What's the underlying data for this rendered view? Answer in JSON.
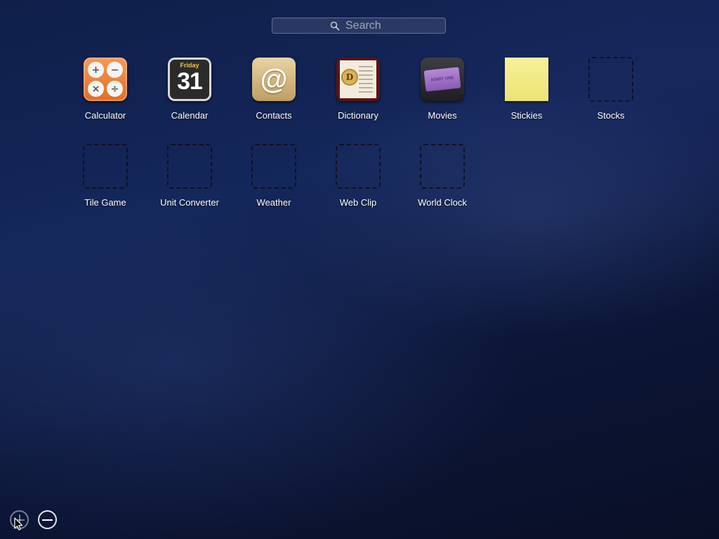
{
  "search": {
    "placeholder": "Search",
    "icon": "magnifying-glass-icon"
  },
  "widgets": [
    {
      "label": "Calculator",
      "icon": "calculator-icon"
    },
    {
      "label": "Calendar",
      "icon": "calendar-icon",
      "day_label": "Friday",
      "date_number": "31"
    },
    {
      "label": "Contacts",
      "icon": "contacts-icon",
      "symbol": "@"
    },
    {
      "label": "Dictionary",
      "icon": "dictionary-icon",
      "seal_letter": "D"
    },
    {
      "label": "Movies",
      "icon": "movies-icon",
      "ticket_text": "ADMIT ONE"
    },
    {
      "label": "Stickies",
      "icon": "stickies-icon"
    },
    {
      "label": "Stocks",
      "icon": "placeholder-icon"
    },
    {
      "label": "Tile Game",
      "icon": "placeholder-icon"
    },
    {
      "label": "Unit Converter",
      "icon": "placeholder-icon"
    },
    {
      "label": "Weather",
      "icon": "placeholder-icon"
    },
    {
      "label": "Web Clip",
      "icon": "placeholder-icon"
    },
    {
      "label": "World Clock",
      "icon": "placeholder-icon"
    }
  ],
  "calculator_keys": [
    "+",
    "−",
    "×",
    "÷"
  ],
  "controls": {
    "add_icon": "plus-circle-icon",
    "remove_icon": "minus-circle-icon"
  },
  "colors": {
    "background": "#14275a",
    "label": "#ffffff"
  }
}
